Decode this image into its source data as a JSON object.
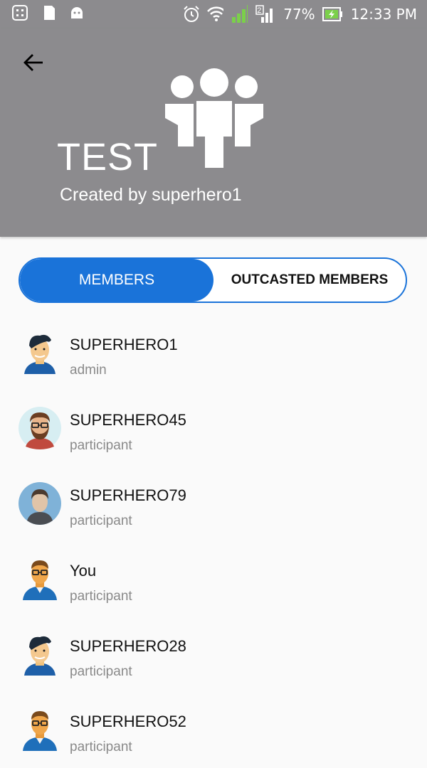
{
  "status_bar": {
    "battery": "77%",
    "time": "12:33 PM",
    "sim_label": "2"
  },
  "header": {
    "title": "TEST",
    "subtitle": "Created by superhero1",
    "background_color": "#8c8b8e"
  },
  "tabs": {
    "members_label": "MEMBERS",
    "outcasted_label": "OUTCASTED MEMBERS",
    "accent_color": "#1a73d9"
  },
  "members": [
    {
      "name": "SUPERHERO1",
      "role": "admin",
      "avatar": "man-dark-hair"
    },
    {
      "name": "SUPERHERO45",
      "role": "participant",
      "avatar": "bearded-man-glasses"
    },
    {
      "name": "SUPERHERO79",
      "role": "participant",
      "avatar": "person-silhouette"
    },
    {
      "name": "You",
      "role": "participant",
      "avatar": "man-glasses-orange"
    },
    {
      "name": "SUPERHERO28",
      "role": "participant",
      "avatar": "man-dark-hair"
    },
    {
      "name": "SUPERHERO52",
      "role": "participant",
      "avatar": "man-glasses-orange"
    }
  ]
}
